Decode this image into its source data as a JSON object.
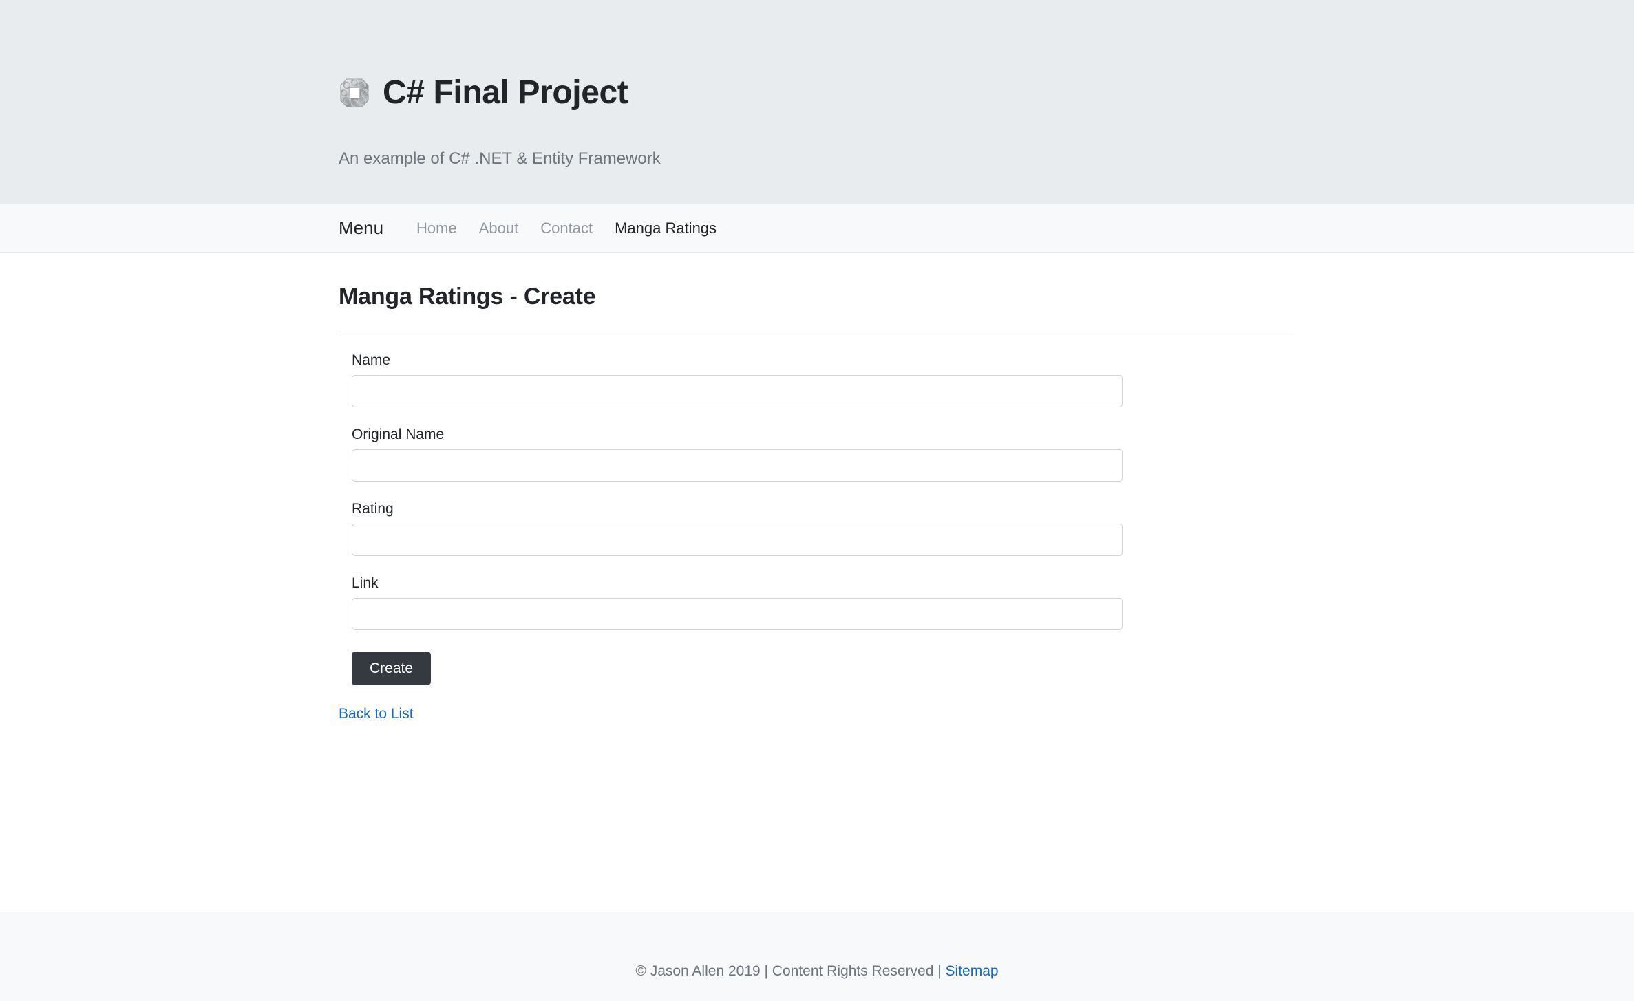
{
  "masthead": {
    "logo_icon": "chain-link-ring-logo",
    "title": "C# Final Project",
    "tagline": "An example of C# .NET & Entity Framework",
    "background_color": "#e9ecef"
  },
  "navbar": {
    "brand_label": "Menu",
    "background_color": "#f8f9fa",
    "links": [
      {
        "label": "Home",
        "active": false
      },
      {
        "label": "About",
        "active": false
      },
      {
        "label": "Contact",
        "active": false
      },
      {
        "label": "Manga Ratings",
        "active": true
      }
    ]
  },
  "main": {
    "page_title": "Manga Ratings - Create",
    "form": {
      "fields": [
        {
          "label": "Name",
          "value": "",
          "placeholder": ""
        },
        {
          "label": "Original Name",
          "value": "",
          "placeholder": ""
        },
        {
          "label": "Rating",
          "value": "",
          "placeholder": ""
        },
        {
          "label": "Link",
          "value": "",
          "placeholder": ""
        }
      ],
      "submit_label": "Create",
      "submit_color": "#343a40"
    },
    "back_link_label": "Back to List",
    "link_color": "#1469c7"
  },
  "footer": {
    "copyright_text": "© Jason Allen 2019 | Content Rights Reserved | ",
    "sitemap_label": "Sitemap",
    "background_color": "#f8f9fa"
  }
}
